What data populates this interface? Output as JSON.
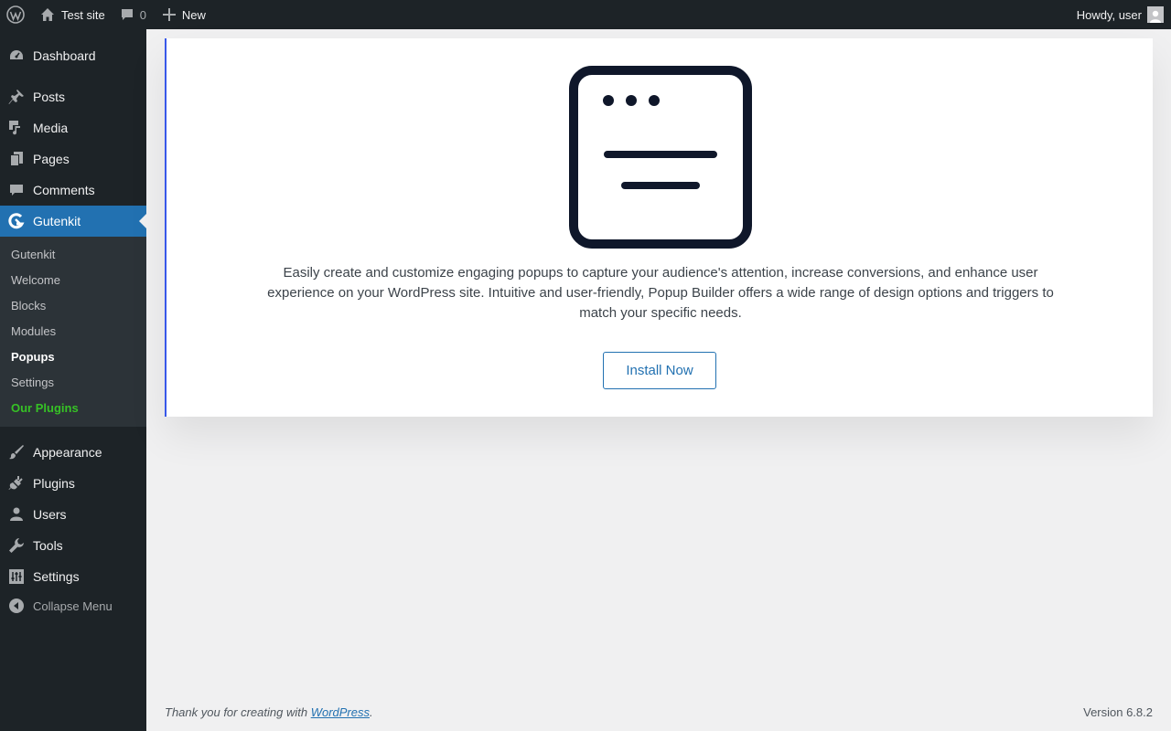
{
  "adminbar": {
    "site_name": "Test site",
    "comments_count": "0",
    "new_label": "New",
    "howdy": "Howdy, user"
  },
  "sidebar": {
    "items": [
      {
        "label": "Dashboard",
        "icon": "dashboard-icon"
      },
      {
        "label": "Posts",
        "icon": "pin-icon"
      },
      {
        "label": "Media",
        "icon": "media-icon"
      },
      {
        "label": "Pages",
        "icon": "pages-icon"
      },
      {
        "label": "Comments",
        "icon": "comment-icon"
      },
      {
        "label": "Gutenkit",
        "icon": "gutenkit-icon"
      },
      {
        "label": "Appearance",
        "icon": "brush-icon"
      },
      {
        "label": "Plugins",
        "icon": "plug-icon"
      },
      {
        "label": "Users",
        "icon": "user-icon"
      },
      {
        "label": "Tools",
        "icon": "wrench-icon"
      },
      {
        "label": "Settings",
        "icon": "sliders-icon"
      }
    ],
    "submenu": [
      "Gutenkit",
      "Welcome",
      "Blocks",
      "Modules",
      "Popups",
      "Settings",
      "Our Plugins"
    ],
    "collapse_label": "Collapse Menu"
  },
  "main": {
    "description": "Easily create and customize engaging popups to capture your audience's attention, increase conversions, and enhance user experience on your WordPress site. Intuitive and user-friendly, Popup Builder offers a wide range of design options and triggers to match your specific needs.",
    "install_label": "Install Now"
  },
  "footer": {
    "thanks": "Thank you for creating with ",
    "link": "WordPress",
    "period": ".",
    "version": "Version 6.8.2"
  },
  "colors": {
    "accent": "#2271b1",
    "card_border": "#3858e9",
    "green": "#36c225",
    "sidebar": "#1d2327"
  }
}
